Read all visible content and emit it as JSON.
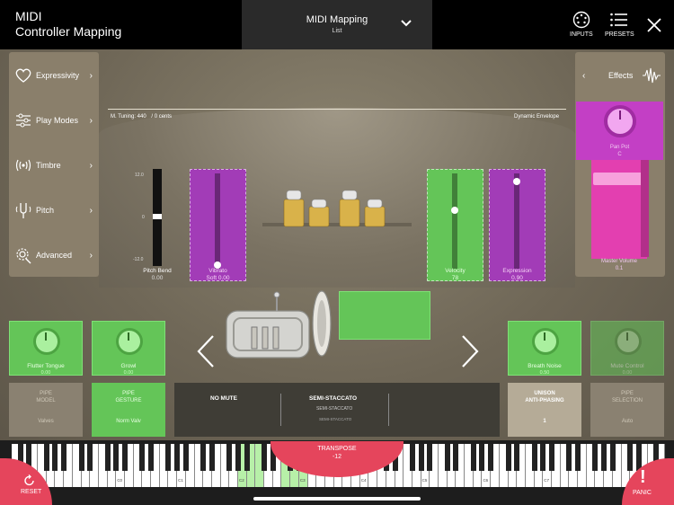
{
  "header": {
    "app_title_line1": "MIDI",
    "app_title_line2": "Controller Mapping",
    "menu_title": "MIDI Mapping",
    "menu_subtitle": "List",
    "inputs_label": "INPUTS",
    "presets_label": "PRESETS"
  },
  "sidebar": {
    "items": [
      {
        "label": "Expressivity",
        "icon": "heart-icon"
      },
      {
        "label": "Play Modes",
        "icon": "sliders-icon"
      },
      {
        "label": "Timbre",
        "icon": "waves-icon"
      },
      {
        "label": "Pitch",
        "icon": "tuning-fork-icon"
      },
      {
        "label": "Advanced",
        "icon": "gear-icon"
      }
    ]
  },
  "effects": {
    "label": "Effects",
    "pan_label": "Pan Pot",
    "pan_value": "C",
    "master_label": "Master Volume",
    "master_value": "0.1",
    "master_level": 0.85
  },
  "stage": {
    "tuning": "M. Tuning: 440",
    "cents": "/ 0 cents",
    "envelope": "Dynamic Envelope"
  },
  "pitch_bend": {
    "label": "Pitch Bend",
    "value": "0.00",
    "scale_top": "12.0",
    "scale_mid": "0",
    "scale_bottom": "-12.0"
  },
  "sliders": {
    "vibrato": {
      "name": "Vibrato",
      "value": "Soft 0.00",
      "level": 0.0
    },
    "velocity": {
      "name": "Velocity",
      "value": "78",
      "level": 0.62
    },
    "expression": {
      "name": "Expression",
      "value": "0.90",
      "level": 0.95
    }
  },
  "tiles": {
    "flutter": {
      "name": "Flutter Tongue",
      "value": "0.00"
    },
    "growl": {
      "name": "Growl",
      "value": "0.00"
    },
    "breath": {
      "name": "Breath Noise",
      "value": "0.50"
    },
    "mute_control": {
      "name": "Mute Control",
      "value": "0.00"
    }
  },
  "bottom_controls": {
    "pipe_model": {
      "l1": "PIPE",
      "l2": "MODEL",
      "value": "Valves"
    },
    "pipe_gesture": {
      "l1": "PIPE",
      "l2": "GESTURE",
      "value": "Norm Valv"
    },
    "mute": "NO MUTE",
    "articulation": "SEMI-STACCATO",
    "articulation_sub": "SEMI-STACCATO",
    "articulation_sub2": "SEMI-STACCATO",
    "unison": {
      "l1": "UNISON",
      "l2": "ANTI-PHASING",
      "value": "1"
    },
    "pipe_selection": {
      "l1": "PIPE",
      "l2": "SELECTION",
      "value": "Auto"
    }
  },
  "keyboard": {
    "transpose_label": "TRANSPOSE",
    "transpose_value": "-12",
    "reset_label": "RESET",
    "panic_label": "PANIC",
    "octaves": [
      "C0",
      "C1",
      "C2",
      "C3",
      "C4",
      "C5",
      "C6",
      "C7"
    ]
  },
  "colors": {
    "green": "#64c558",
    "purple": "#a23cb7",
    "pink": "#e33fb0",
    "red": "#e5455c"
  }
}
